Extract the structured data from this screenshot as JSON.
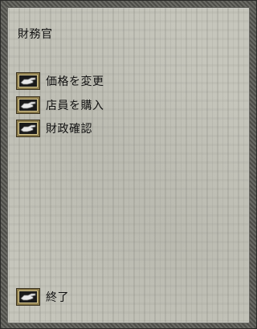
{
  "title": "財務官",
  "menu": [
    {
      "label": "価格を変更",
      "icon": "pointing-hand-icon"
    },
    {
      "label": "店員を購入",
      "icon": "pointing-hand-icon"
    },
    {
      "label": "財政確認",
      "icon": "pointing-hand-icon"
    }
  ],
  "exit": {
    "label": "終了",
    "icon": "pointing-hand-icon"
  }
}
